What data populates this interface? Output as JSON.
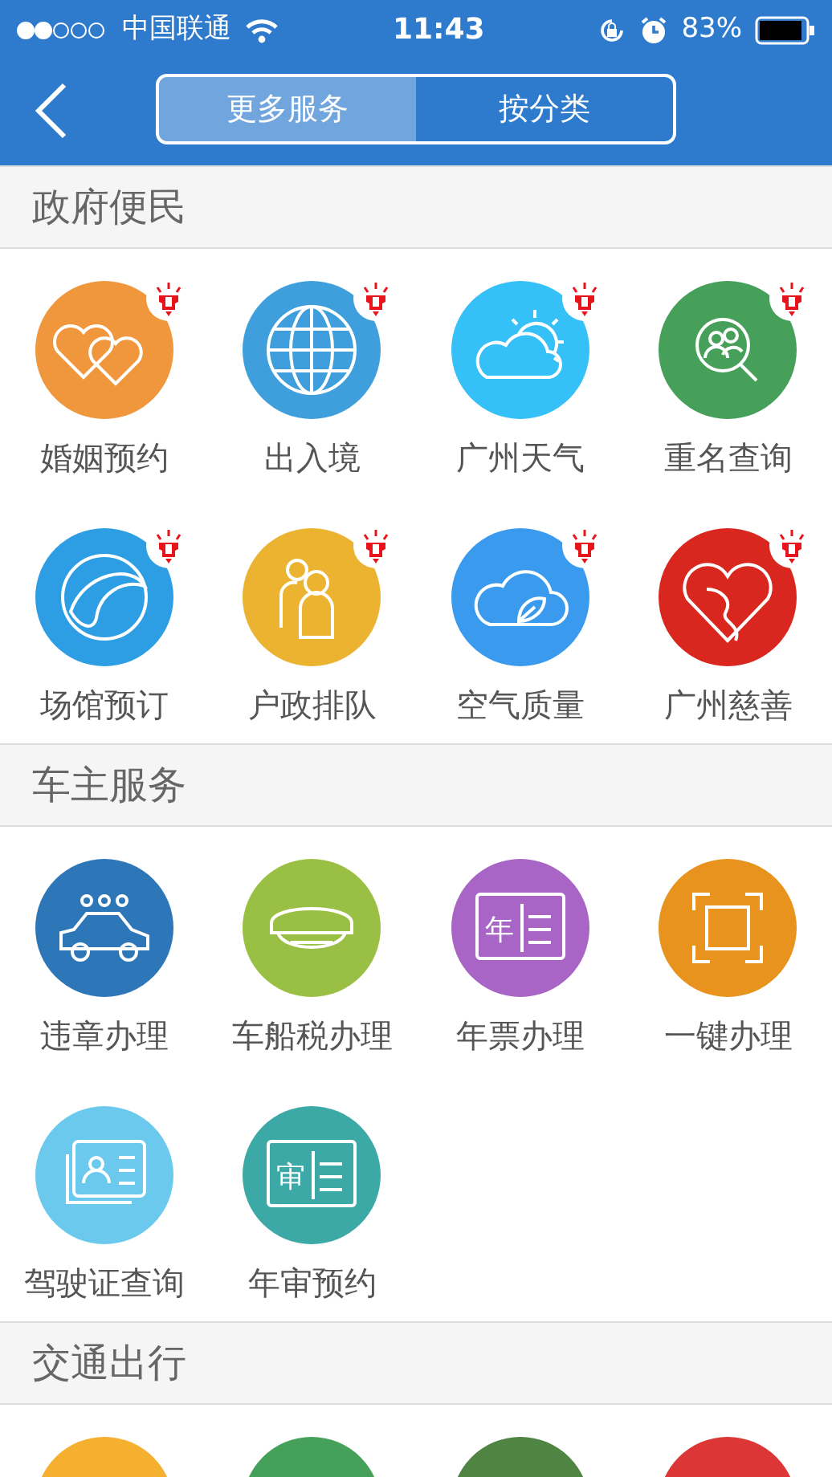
{
  "status_bar": {
    "carrier": "中国联通",
    "time": "11:43",
    "battery": "83%"
  },
  "nav": {
    "tabs": [
      {
        "label": "更多服务",
        "selected": true
      },
      {
        "label": "按分类",
        "selected": false
      }
    ]
  },
  "sections": [
    {
      "title": "政府便民",
      "items": [
        {
          "label": "婚姻预约",
          "color": "#f0963c",
          "badge": true
        },
        {
          "label": "出入境",
          "color": "#3e9fdc",
          "badge": true
        },
        {
          "label": "广州天气",
          "color": "#35c0f7",
          "badge": true
        },
        {
          "label": "重名查询",
          "color": "#47a05a",
          "badge": true
        },
        {
          "label": "场馆预订",
          "color": "#2d9ee4",
          "badge": true
        },
        {
          "label": "户政排队",
          "color": "#ebb330",
          "badge": true
        },
        {
          "label": "空气质量",
          "color": "#3a9bee",
          "badge": true
        },
        {
          "label": "广州慈善",
          "color": "#d9271f",
          "badge": true
        }
      ]
    },
    {
      "title": "车主服务",
      "items": [
        {
          "label": "违章办理",
          "color": "#2d77b8"
        },
        {
          "label": "车船税办理",
          "color": "#9abf45"
        },
        {
          "label": "年票办理",
          "color": "#a865c6",
          "glyph": "年"
        },
        {
          "label": "一键办理",
          "color": "#e8931e"
        },
        {
          "label": "驾驶证查询",
          "color": "#6cc9ee"
        },
        {
          "label": "年审预约",
          "color": "#3ca9a7",
          "glyph": "审"
        }
      ]
    },
    {
      "title": "交通出行",
      "items": [
        {
          "color": "#f6b030"
        },
        {
          "color": "#45a05a"
        },
        {
          "color": "#4f8442"
        },
        {
          "color": "#dc3636"
        }
      ]
    }
  ]
}
